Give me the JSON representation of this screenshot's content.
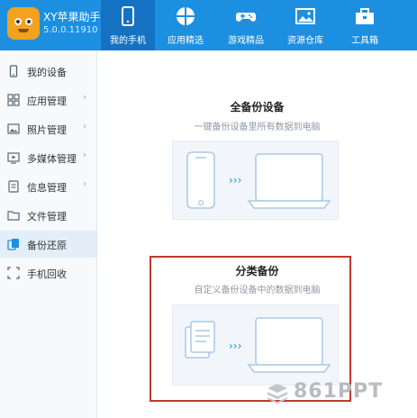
{
  "app": {
    "title": "XY苹果助手",
    "version": "5.0.0.11910",
    "logo_icon": "xy-mascot-icon",
    "brand_color": "#1d8fe0",
    "active_tab_color": "#1572c2"
  },
  "tabs": [
    {
      "label": "我的手机",
      "icon": "phone-icon",
      "active": true
    },
    {
      "label": "应用精选",
      "icon": "apps-icon",
      "active": false
    },
    {
      "label": "游戏精品",
      "icon": "gamepad-icon",
      "active": false
    },
    {
      "label": "资源仓库",
      "icon": "image-icon",
      "active": false
    },
    {
      "label": "工具箱",
      "icon": "toolbox-icon",
      "active": false
    }
  ],
  "sidebar": {
    "items": [
      {
        "label": "我的设备",
        "icon": "device-icon",
        "has_submenu": false,
        "active": false
      },
      {
        "label": "应用管理",
        "icon": "grid-icon",
        "has_submenu": true,
        "active": false
      },
      {
        "label": "照片管理",
        "icon": "photo-icon",
        "has_submenu": true,
        "active": false
      },
      {
        "label": "多媒体管理",
        "icon": "media-icon",
        "has_submenu": true,
        "active": false
      },
      {
        "label": "信息管理",
        "icon": "message-icon",
        "has_submenu": true,
        "active": false
      },
      {
        "label": "文件管理",
        "icon": "folder-icon",
        "has_submenu": false,
        "active": false
      },
      {
        "label": "备份还原",
        "icon": "backup-icon",
        "has_submenu": false,
        "active": true
      },
      {
        "label": "手机回收",
        "icon": "recycle-icon",
        "has_submenu": false,
        "active": false
      }
    ]
  },
  "main": {
    "full_backup": {
      "title": "全备份设备",
      "subtitle": "一键备份设备里所有数据到电脑"
    },
    "category_backup": {
      "title": "分类备份",
      "subtitle": "自定义备份设备中的数据到电脑",
      "highlighted": true,
      "highlight_color": "#c0392b"
    }
  },
  "watermark": {
    "text": "861PPT"
  }
}
